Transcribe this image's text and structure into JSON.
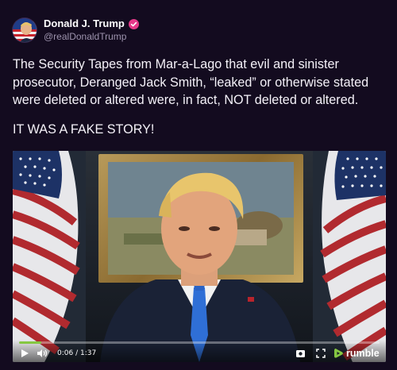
{
  "author": {
    "display_name": "Donald J. Trump",
    "handle": "@realDonaldTrump",
    "verified": true,
    "verified_color": "#e6398a"
  },
  "post": {
    "text": "The Security Tapes from Mar-a-Lago that evil and sinister prosecutor, Deranged Jack Smith, “leaked” or otherwise stated were deleted or altered were, in fact, NOT deleted or altered.",
    "text2": "IT WAS A FAKE STORY!"
  },
  "video": {
    "time": "0:06 / 1:37",
    "progress": 0.062,
    "progress_color": "#85c742",
    "provider": "rumble",
    "controls": {
      "play_icon": "play-icon",
      "volume_icon": "volume-icon",
      "settings_icon": "settings-icon",
      "fullscreen_icon": "fullscreen-icon"
    }
  },
  "colors": {
    "background": "#130b1f",
    "text": "#f4f1f8",
    "handle": "#9d93ad",
    "rumble": "#85c742"
  }
}
